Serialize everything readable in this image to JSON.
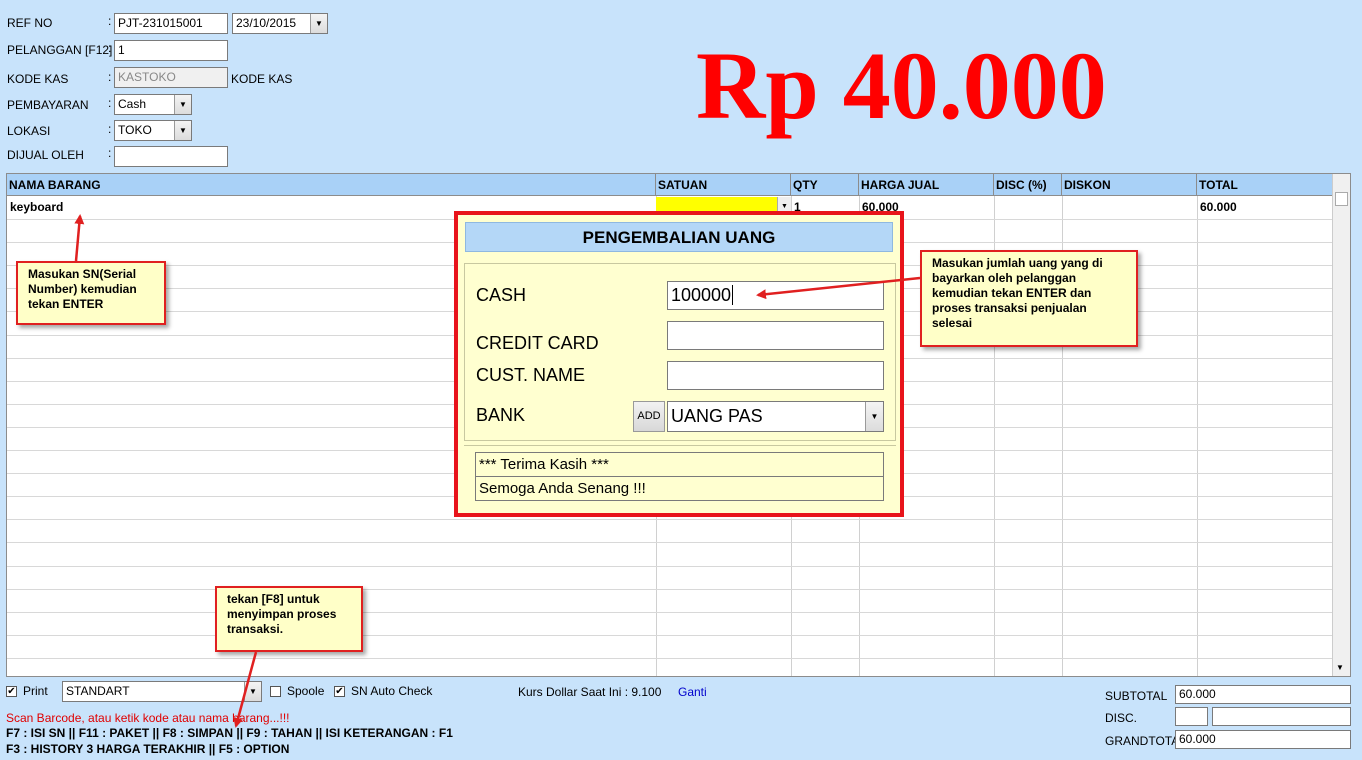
{
  "header": {
    "ref_no_label": "REF NO",
    "ref_no": "PJT-231015001",
    "date": "23/10/2015",
    "pelanggan_label": "PELANGGAN [F12]",
    "pelanggan": "1",
    "kode_kas_label": "KODE KAS",
    "kode_kas": "KASTOKO",
    "kode_kas_suffix": "KODE KAS",
    "pembayaran_label": "PEMBAYARAN",
    "pembayaran": "Cash",
    "lokasi_label": "LOKASI",
    "lokasi": "TOKO",
    "dijual_oleh_label": "DIJUAL OLEH",
    "dijual_oleh": "",
    "colon": ":"
  },
  "total_display": "Rp 40.000",
  "grid": {
    "columns": [
      "NAMA BARANG",
      "SATUAN",
      "QTY",
      "HARGA JUAL",
      "DISC (%)",
      "DISKON",
      "TOTAL"
    ],
    "rows": [
      {
        "nama": "keyboard",
        "satuan": "",
        "qty": "1",
        "harga": "60.000",
        "disc": "",
        "diskon": "",
        "total": "60.000"
      }
    ]
  },
  "callouts": {
    "sn": "Masukan SN(Serial Number) kemudian tekan ENTER",
    "cash": "Masukan jumlah uang yang di bayarkan oleh pelanggan kemudian tekan ENTER dan proses transaksi penjualan selesai",
    "f8": "tekan [F8] untuk menyimpan proses transaksi."
  },
  "dialog": {
    "title": "PENGEMBALIAN UANG",
    "cash_label": "CASH",
    "cash_value": "100000",
    "credit_label": "CREDIT CARD",
    "credit_value": "",
    "cust_label": "CUST. NAME",
    "cust_value": "",
    "bank_label": "BANK",
    "add_label": "ADD",
    "bank_value": "UANG PAS",
    "msg1": "*** Terima Kasih ***",
    "msg2": "Semoga Anda Senang !!!"
  },
  "bottom": {
    "print_label": "Print",
    "print_checked": true,
    "print_mode": "STANDART",
    "spoole_label": "Spoole",
    "spoole_checked": false,
    "sn_auto_label": "SN Auto Check",
    "sn_auto_checked": true,
    "kurs_label": "Kurs Dollar Saat Ini : 9.100",
    "ganti_label": "Ganti",
    "hint": "Scan Barcode, atau ketik kode atau nama barang...!!!",
    "keys_line1": "F7 : ISI SN  ||  F11 : PAKET  ||  F8 : SIMPAN  ||  F9 : TAHAN  ||  ISI KETERANGAN : F1",
    "keys_line2": "F3 : HISTORY 3 HARGA TERAKHIR  ||  F5 : OPTION"
  },
  "summary": {
    "subtotal_label": "SUBTOTAL",
    "subtotal": "60.000",
    "disc_label": "DISC.",
    "disc_pct": "",
    "disc_value": "",
    "grandtotal_label": "GRANDTOTAL",
    "grandtotal": "60.000"
  },
  "colors": {
    "background": "#c8e3fb",
    "total_red": "#ff0000",
    "dialog_border": "#e8141b",
    "callout_bg": "#ffffc8",
    "grid_header": "#a9d1f7"
  }
}
